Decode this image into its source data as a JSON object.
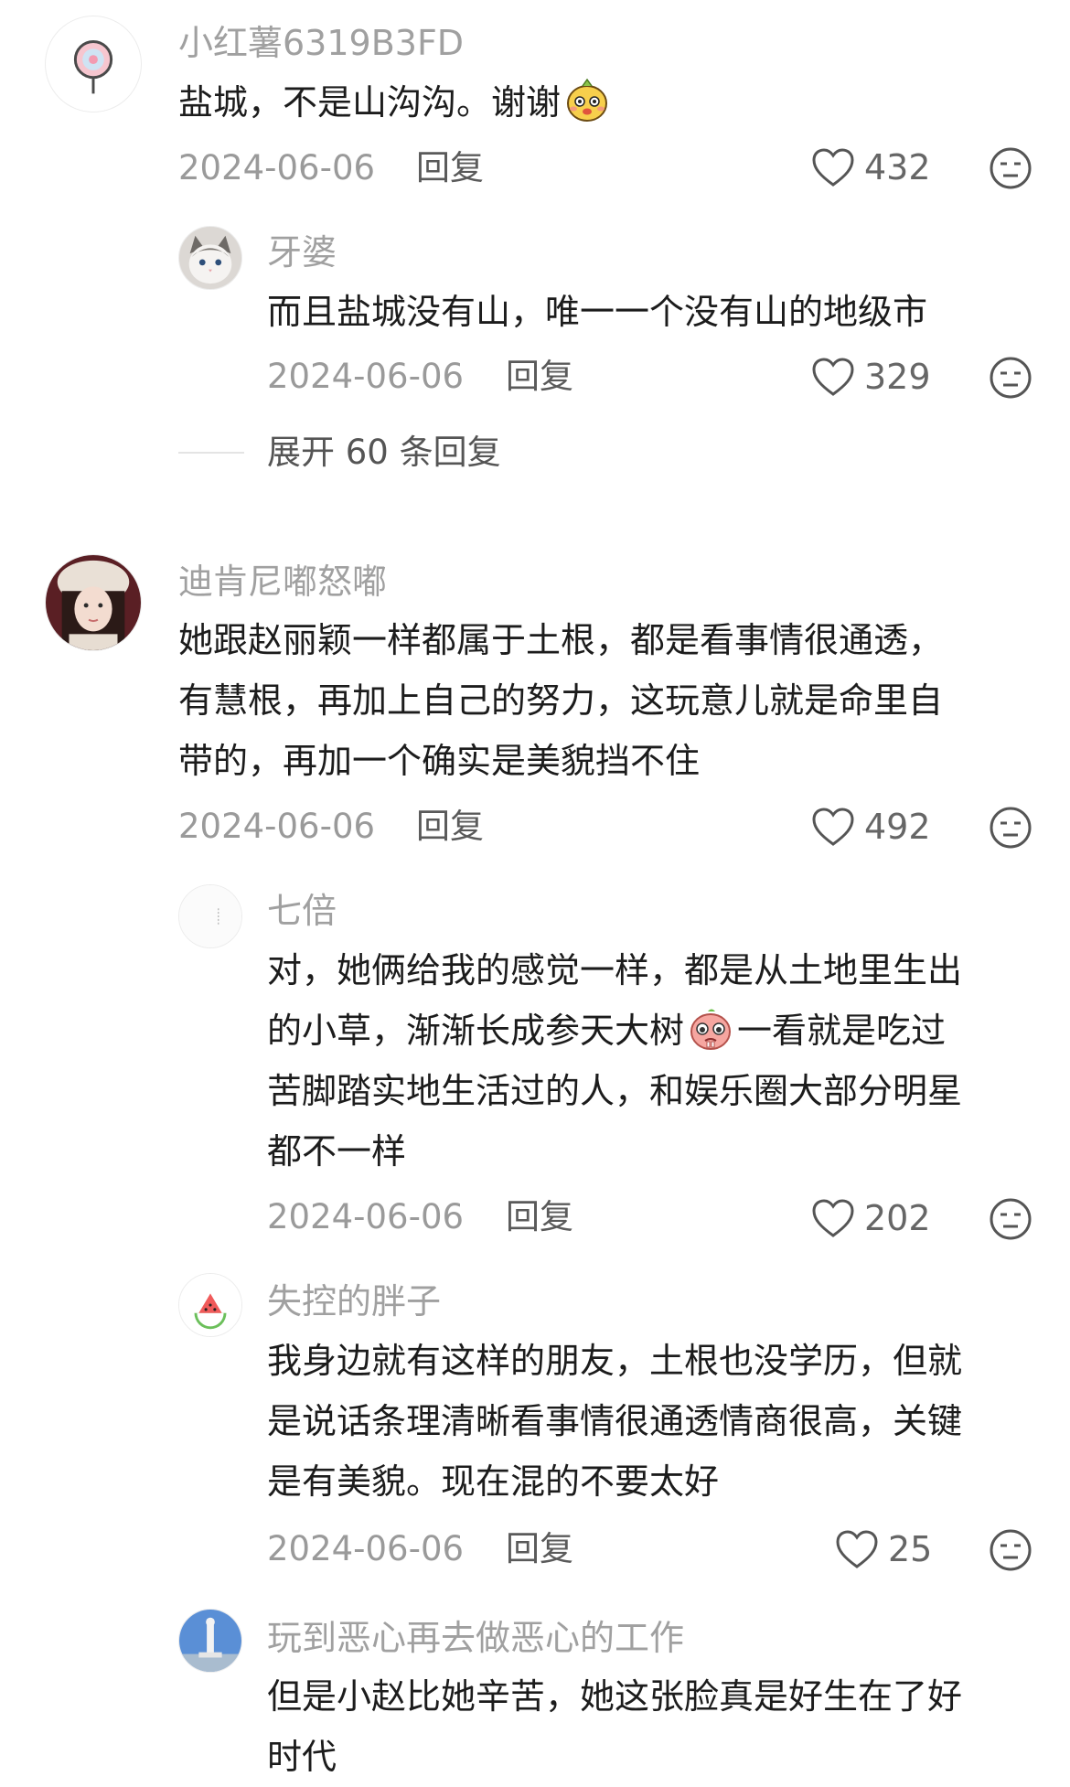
{
  "comments": [
    {
      "user": "小红薯6319B3FD",
      "text_lines": [
        "盐城，不是山沟沟。谢谢"
      ],
      "date": "2024-06-06",
      "reply_label": "回复",
      "likes": "432",
      "replies": [
        {
          "user": "牙婆",
          "text_lines": [
            "而且盐城没有山，唯一一个没有山的地级市"
          ],
          "date": "2024-06-06",
          "reply_label": "回复",
          "likes": "329"
        }
      ],
      "expand_label": "展开 60 条回复"
    },
    {
      "user": "迪肯尼嘟怒嘟",
      "text_lines": [
        "她跟赵丽颖一样都属于土根，都是看事情很通透，",
        "有慧根，再加上自己的努力，这玩意儿就是命里自",
        "带的，再加一个确实是美貌挡不住"
      ],
      "date": "2024-06-06",
      "reply_label": "回复",
      "likes": "492",
      "replies": [
        {
          "user": "七倍",
          "text_lines": [
            "对，她俩给我的感觉一样，都是从土地里生出",
            "的小草，渐渐长成参天大树",
            "一看就是吃过",
            "苦脚踏实地生活过的人，和娱乐圈大部分明星",
            "都不一样"
          ],
          "date": "2024-06-06",
          "reply_label": "回复",
          "likes": "202"
        },
        {
          "user": "失控的胖子",
          "text_lines": [
            "我身边就有这样的朋友，土根也没学历，但就",
            "是说话条理清晰看事情很通透情商很高，关键",
            "是有美貌。现在混的不要太好"
          ],
          "date": "2024-06-06",
          "reply_label": "回复",
          "likes": "25"
        },
        {
          "user": "玩到恶心再去做恶心的工作",
          "text_lines": [
            "但是小赵比她辛苦，她这张脸真是好生在了好",
            "时代"
          ],
          "date": "",
          "reply_label": "",
          "likes": ""
        }
      ]
    }
  ],
  "icons": {
    "like": "heart-outline-icon",
    "dislike": "unimpressed-face-icon",
    "emoji_1": "yellow-cartoon-emoji",
    "emoji_2": "pink-crying-emoji"
  }
}
